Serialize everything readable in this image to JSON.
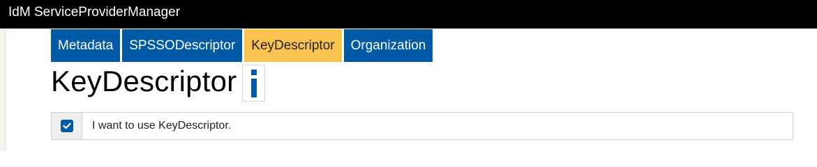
{
  "app": {
    "title": "IdM ServiceProviderManager"
  },
  "tabs": [
    {
      "label": "Metadata",
      "active": false
    },
    {
      "label": "SPSSODescriptor",
      "active": false
    },
    {
      "label": "KeyDescriptor",
      "active": true
    },
    {
      "label": "Organization",
      "active": false
    }
  ],
  "page": {
    "title": "KeyDescriptor",
    "info_icon": "info-icon"
  },
  "option": {
    "checked": true,
    "label": "I want to use KeyDescriptor."
  },
  "colors": {
    "topbar": "#000000",
    "tab": "#005aa6",
    "tab_active": "#fac34f",
    "checkbox": "#005aa6"
  }
}
